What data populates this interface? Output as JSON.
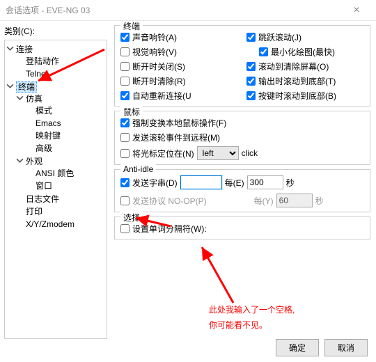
{
  "window": {
    "title": "会话选项 - EVE-NG 03"
  },
  "left": {
    "label": "类别(C):",
    "tree": {
      "connection": "连接",
      "login": "登陆动作",
      "telnet": "Telnet",
      "terminal": "终端",
      "emulation": "仿真",
      "mode": "模式",
      "emacs": "Emacs",
      "keymap": "映射键",
      "advanced": "高级",
      "appearance": "外观",
      "ansicolor": "ANSI 颜色",
      "window": "窗口",
      "logfile": "日志文件",
      "print": "打印",
      "xyz": "X/Y/Zmodem"
    }
  },
  "groups": {
    "terminal": {
      "title": "终端",
      "audiobell": "声音响铃(A)",
      "visualbell": "视觉响铃(V)",
      "closeondisc": "断开时关闭(S)",
      "clearondisc": "断开时清除(R)",
      "autoreconn": "自动重新连接(U",
      "jumpscroll": "跳跃滚动(J)",
      "minredraw": "最小化绘图(最快)",
      "scrolltoclr": "滚动到清除屏幕(O)",
      "scrollbottomout": "输出时滚动到底部(T)",
      "scrollbottomkey": "按键时滚动到底部(B)"
    },
    "mouse": {
      "title": "鼠标",
      "forcelocal": "强制变换本地鼠标操作(F)",
      "sendwheel": "发送滚轮事件到远程(M)",
      "positioncursor": "将光标定位在(N)",
      "sel": "left",
      "click": "click"
    },
    "antiidle": {
      "title": "Anti-idle",
      "sendstr": "发送字串(D)",
      "every1": "每(E)",
      "val1": "300",
      "sec": "秒",
      "sendnoop": "发送协议 NO-OP(P)",
      "every2": "每(Y)",
      "val2": "60"
    },
    "select": {
      "title": "选择",
      "worddelim": "设置单词分隔符(W):"
    }
  },
  "footer": {
    "ok": "确定",
    "cancel": "取消"
  },
  "annotation": {
    "line1": "此处我输入了一个空格,",
    "line2": "你可能看不见。"
  }
}
